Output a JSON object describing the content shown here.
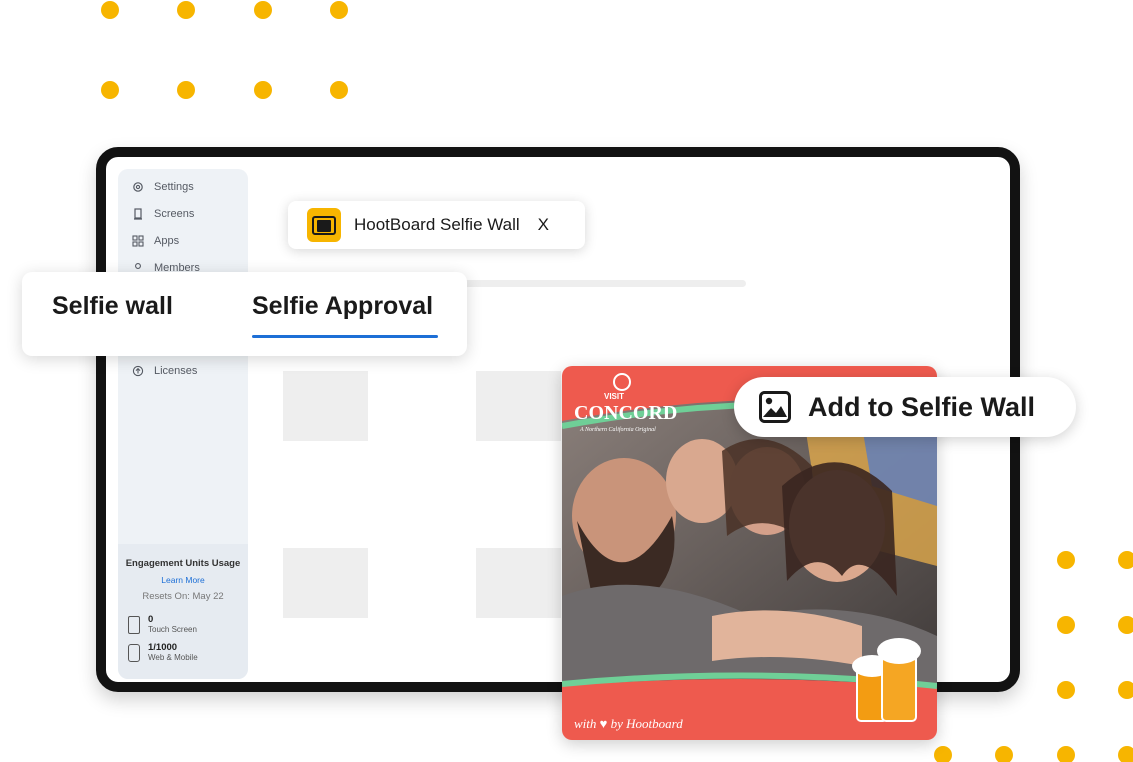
{
  "sidebar": {
    "items": [
      {
        "label": "Settings",
        "icon": "gear-icon"
      },
      {
        "label": "Screens",
        "icon": "screen-icon"
      },
      {
        "label": "Apps",
        "icon": "grid-icon"
      },
      {
        "label": "Members",
        "icon": "user-icon"
      }
    ],
    "licenses_label": "Licenses",
    "licenses_icon": "arrow-up-circle-icon"
  },
  "usage": {
    "title": "Engagement Units Usage",
    "learn_more": "Learn More",
    "reset": "Resets On: May 22",
    "touch": {
      "value": "0",
      "label": "Touch Screen"
    },
    "web": {
      "value": "1/1000",
      "label": "Web & Mobile"
    }
  },
  "app_chip": {
    "name": "HootBoard Selfie Wall",
    "close": "X",
    "logo_icon": "selfie-wall-app-icon"
  },
  "tabs": [
    {
      "label": "Selfie wall",
      "active": false
    },
    {
      "label": "Selfie Approval",
      "active": true
    }
  ],
  "action": {
    "label": "Add to Selfie Wall",
    "icon": "image-icon"
  },
  "photo": {
    "brand_top": "VISIT",
    "brand_main": "CONCORD",
    "brand_sub": "A Northern California Original",
    "footer": "with ♥ by Hootboard"
  },
  "colors": {
    "accent_yellow": "#f7b500",
    "accent_blue": "#1d6fd6",
    "frame_red": "#ee5a4e",
    "frame_green": "#6fcf97"
  }
}
